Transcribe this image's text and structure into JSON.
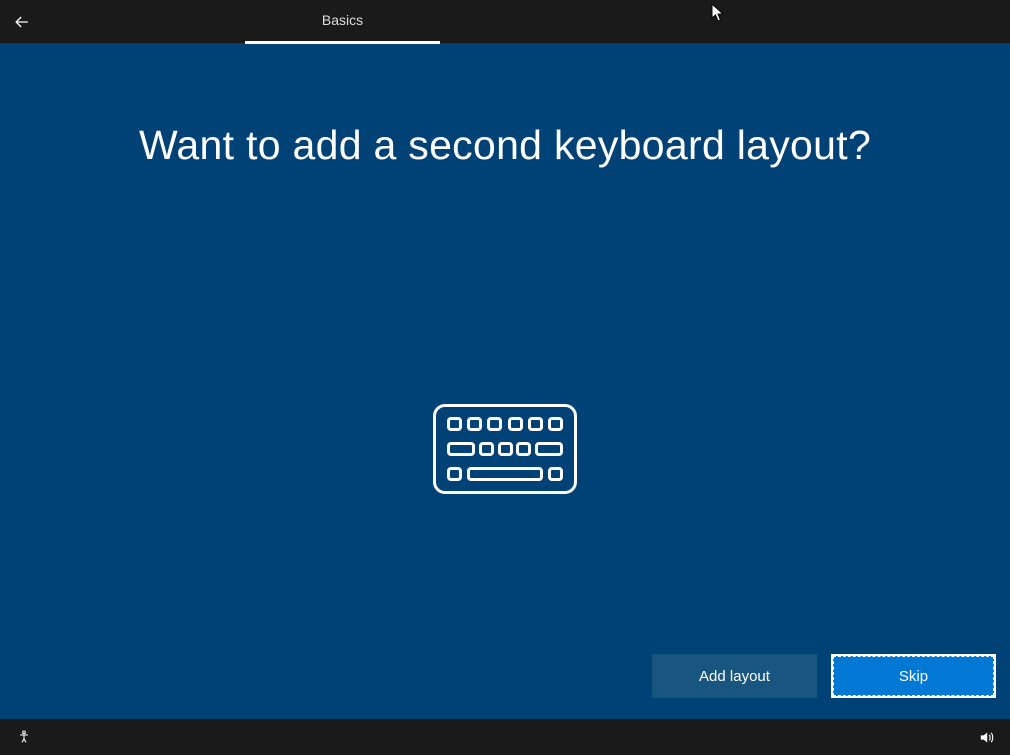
{
  "header": {
    "tab_label": "Basics"
  },
  "main": {
    "heading": "Want to add a second keyboard layout?"
  },
  "buttons": {
    "add_layout": "Add layout",
    "skip": "Skip"
  }
}
